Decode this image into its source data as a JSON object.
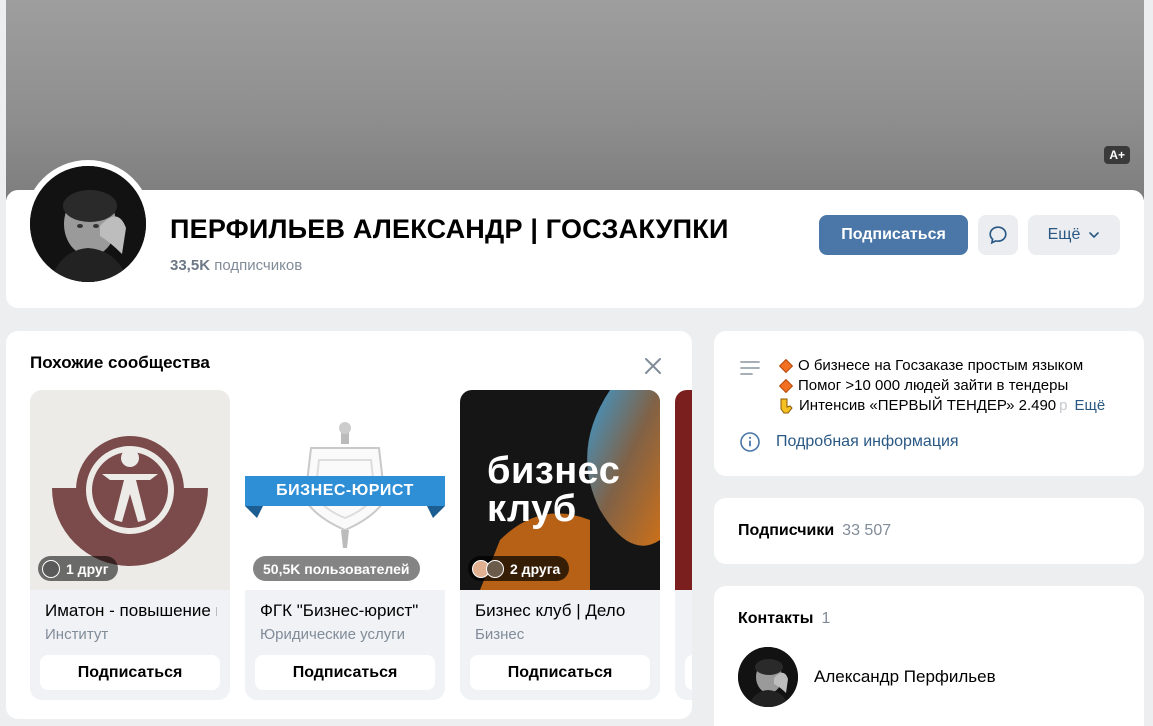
{
  "cover": {
    "badge": "A+"
  },
  "profile": {
    "title": "ПЕРФИЛЬЕВ АЛЕКСАНДР | ГОСЗАКУПКИ",
    "subscribers_count": "33,5K",
    "subscribers_label": "подписчиков",
    "subscribe_label": "Подписаться",
    "more_label": "Ещё"
  },
  "similar": {
    "title": "Похожие сообщества",
    "communities": [
      {
        "name": "Иматон - повышение квалификации",
        "category": "Институт",
        "badge": "1 друг",
        "button": "Подписаться"
      },
      {
        "name": "ФГК \"Бизнес-юрист\"",
        "category": "Юридические услуги",
        "badge": "50,5K пользователей",
        "button": "Подписаться",
        "logo_text": "БИЗНЕС-ЮРИСТ"
      },
      {
        "name": "Бизнес клуб | Дело",
        "category": "Бизнес",
        "badge": "2 друга",
        "button": "Подписаться",
        "logo_line1": "бизнес",
        "logo_line2": "клуб"
      }
    ]
  },
  "description": {
    "line1": "О бизнесе на Госзаказе простым языком",
    "line2": "Помог >10 000 людей зайти в тендеры",
    "line3": "Интенсив «ПЕРВЫЙ ТЕНДЕР» 2.490",
    "line3_faded": "р",
    "more": "Ещё",
    "info_link": "Подробная информация"
  },
  "subscribers": {
    "label": "Подписчики",
    "count": "33 507"
  },
  "contacts": {
    "label": "Контакты",
    "count": "1",
    "items": [
      {
        "name": "Александр Перфильев"
      }
    ]
  },
  "colors": {
    "accent": "#4a76a8",
    "link": "#2a5885",
    "secondary": "#818c99",
    "background": "#edeef0"
  }
}
